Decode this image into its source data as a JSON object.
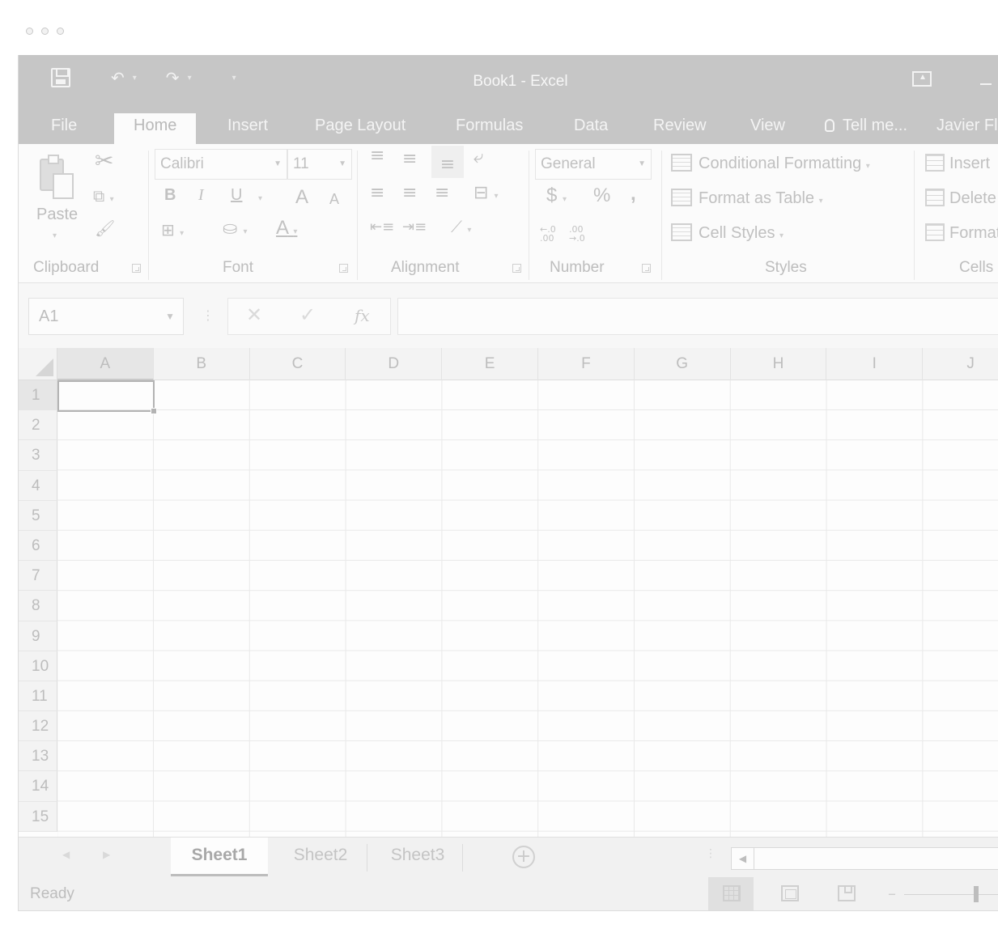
{
  "window": {
    "title": "Book1 - Excel"
  },
  "quick_access": {
    "save_icon": "save-icon",
    "undo_icon": "undo-icon",
    "redo_icon": "redo-icon",
    "customize_icon": "customize-qat-icon"
  },
  "tabs": [
    {
      "label": "File"
    },
    {
      "label": "Home"
    },
    {
      "label": "Insert"
    },
    {
      "label": "Page Layout"
    },
    {
      "label": "Formulas"
    },
    {
      "label": "Data"
    },
    {
      "label": "Review"
    },
    {
      "label": "View"
    }
  ],
  "tell_me": "Tell me...",
  "user_name": "Javier Fl",
  "ribbon": {
    "clipboard": {
      "paste_label": "Paste",
      "group_label": "Clipboard"
    },
    "font": {
      "font_name": "Calibri",
      "font_size": "11",
      "bold": "B",
      "italic": "I",
      "underline": "U",
      "grow": "A",
      "shrink": "A",
      "font_color": "A",
      "group_label": "Font"
    },
    "alignment": {
      "group_label": "Alignment"
    },
    "number": {
      "format": "General",
      "currency": "$",
      "percent": "%",
      "comma": ",",
      "inc_decimal": "←.0 .00",
      "dec_decimal": ".00 →.0",
      "group_label": "Number"
    },
    "styles": {
      "conditional_formatting": "Conditional Formatting",
      "format_as_table": "Format as Table",
      "cell_styles": "Cell Styles",
      "group_label": "Styles"
    },
    "cells": {
      "insert": "Insert",
      "delete": "Delete",
      "format": "Format",
      "group_label": "Cells"
    }
  },
  "formula_bar": {
    "name_box": "A1",
    "cancel": "✕",
    "enter": "✓",
    "fx": "fx",
    "value": ""
  },
  "grid": {
    "columns": [
      "A",
      "B",
      "C",
      "D",
      "E",
      "F",
      "G",
      "H",
      "I",
      "J"
    ],
    "rows": [
      "1",
      "2",
      "3",
      "4",
      "5",
      "6",
      "7",
      "8",
      "9",
      "10",
      "11",
      "12",
      "13",
      "14",
      "15"
    ],
    "selected_cell": "A1"
  },
  "sheets": [
    {
      "label": "Sheet1",
      "active": true
    },
    {
      "label": "Sheet2",
      "active": false
    },
    {
      "label": "Sheet3",
      "active": false
    }
  ],
  "status": {
    "text": "Ready"
  },
  "colors": {
    "titlebar": "#c6c6c6",
    "ribbon": "#fbfbfb",
    "text": "#bdbdbd"
  }
}
